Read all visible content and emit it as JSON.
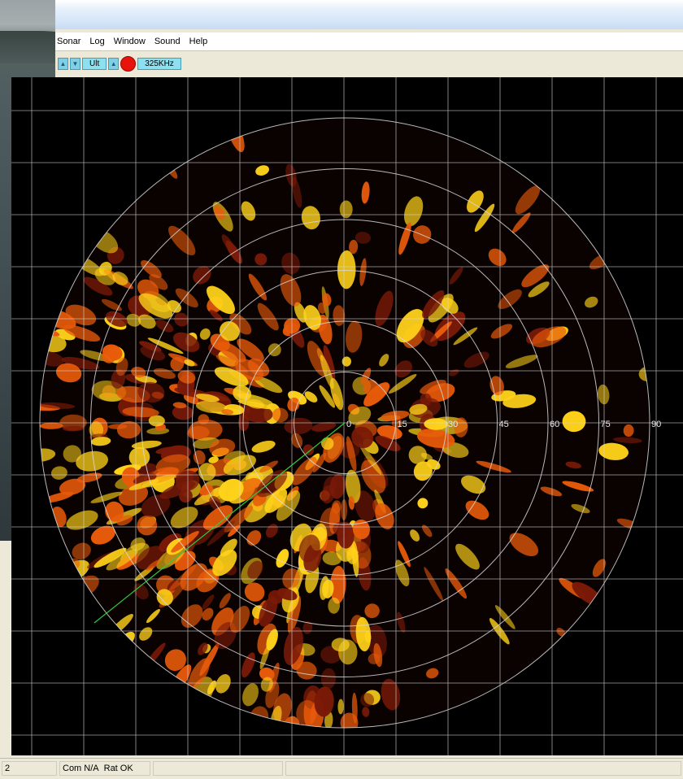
{
  "menu": {
    "items": [
      "Sonar",
      "Log",
      "Window",
      "Sound",
      "Help"
    ]
  },
  "toolbar": {
    "gain_field": "Ult",
    "frequency": "325KHz",
    "record_color": "#e8140c"
  },
  "sonar": {
    "range_labels": [
      "0",
      "15",
      "30",
      "45",
      "60",
      "75",
      "90"
    ],
    "heading_line_color": "#2ecc40",
    "grid_color": "#d8d8d8",
    "echo_color_low": "#7a1a08",
    "echo_color_mid": "#e85a0a",
    "echo_color_high": "#ffd21a"
  },
  "status": {
    "field1": "2",
    "field2": "Com N/A",
    "field3": "Rat OK"
  },
  "icons": {
    "up": "chevron-up-icon",
    "down": "chevron-down-icon",
    "record": "record-icon"
  }
}
